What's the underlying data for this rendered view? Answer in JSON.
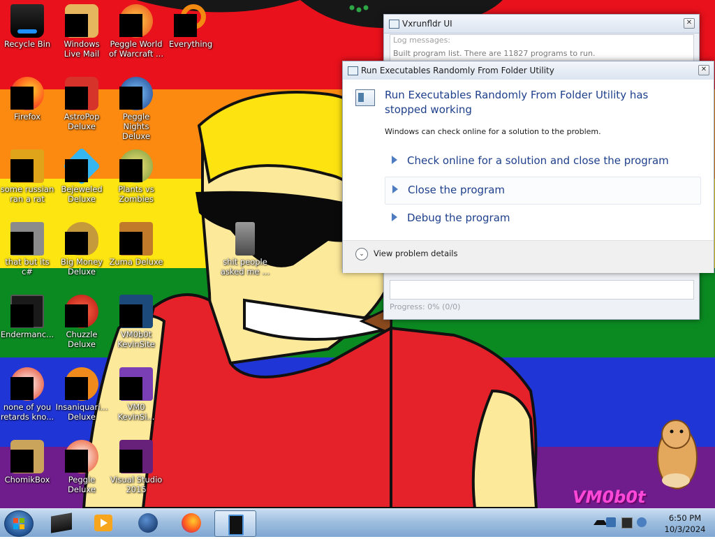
{
  "desktop": {
    "icons": [
      {
        "label": "Recycle Bin",
        "icon": "recycle-bin-icon"
      },
      {
        "label": "Windows Live Mail",
        "icon": "mail-icon"
      },
      {
        "label": "Peggle World of Warcraft ...",
        "icon": "peggle-icon"
      },
      {
        "label": "Everything",
        "icon": "search-icon"
      },
      {
        "label": "Firefox",
        "icon": "firefox-icon"
      },
      {
        "label": "AstroPop Deluxe",
        "icon": "game-icon"
      },
      {
        "label": "Peggle Nights Deluxe",
        "icon": "peggle-icon"
      },
      {
        "label": "some russian ran a rat",
        "icon": "app-icon"
      },
      {
        "label": "Bejeweled Deluxe",
        "icon": "gem-icon"
      },
      {
        "label": "Plants vs Zombies",
        "icon": "plant-icon"
      },
      {
        "label": "that but its c#",
        "icon": "folder-icon"
      },
      {
        "label": "Big Money Deluxe",
        "icon": "money-bag-icon"
      },
      {
        "label": "Zuma Deluxe",
        "icon": "zuma-icon"
      },
      {
        "label": "Endermanc...",
        "icon": "terminal-icon"
      },
      {
        "label": "Chuzzle Deluxe",
        "icon": "chuzzle-icon"
      },
      {
        "label": "VM0b0t KevinSite",
        "icon": "visual-studio-icon"
      },
      {
        "label": "none of you retards kno...",
        "icon": "app-icon"
      },
      {
        "label": "Insaniquari... Deluxe",
        "icon": "fish-icon"
      },
      {
        "label": "VM0 KevinSi...",
        "icon": "visual-studio-icon"
      },
      {
        "label": "ChomikBox",
        "icon": "chomikbox-icon"
      },
      {
        "label": "Peggle Deluxe",
        "icon": "peggle-icon"
      },
      {
        "label": "Visual Studio 2015",
        "icon": "visual-studio-icon"
      },
      {
        "label": "shit people asked me ...",
        "icon": "folder-icon"
      }
    ],
    "watermark": "VM0b0t"
  },
  "vx_window": {
    "title": "Vxrunfldr UI",
    "log_placeholder": "Log messages:",
    "log_line": "Built program list. There are 11827 programs to run.",
    "progress": "Progress: 0% (0/0)"
  },
  "crash_dialog": {
    "title": "Run Executables Randomly From Folder Utility",
    "heading": "Run Executables Randomly From Folder Utility has stopped working",
    "subtext": "Windows can check online for a solution to the problem.",
    "options": [
      "Check online for a solution and close the program",
      "Close the program",
      "Debug the program"
    ],
    "details_label": "View problem details"
  },
  "taskbar": {
    "items": [
      "app-icon",
      "media-player-icon",
      "globe-icon",
      "firefox-icon",
      "vxrunfldr-icon"
    ],
    "clock_time": "6:50 PM",
    "clock_date": "10/3/2024"
  },
  "colors": {
    "dialog_heading": "#1e3f8c",
    "rainbow": [
      "#e8111c",
      "#fd8a10",
      "#fde512",
      "#0b8a22",
      "#2035d6",
      "#6f1d8c"
    ]
  }
}
